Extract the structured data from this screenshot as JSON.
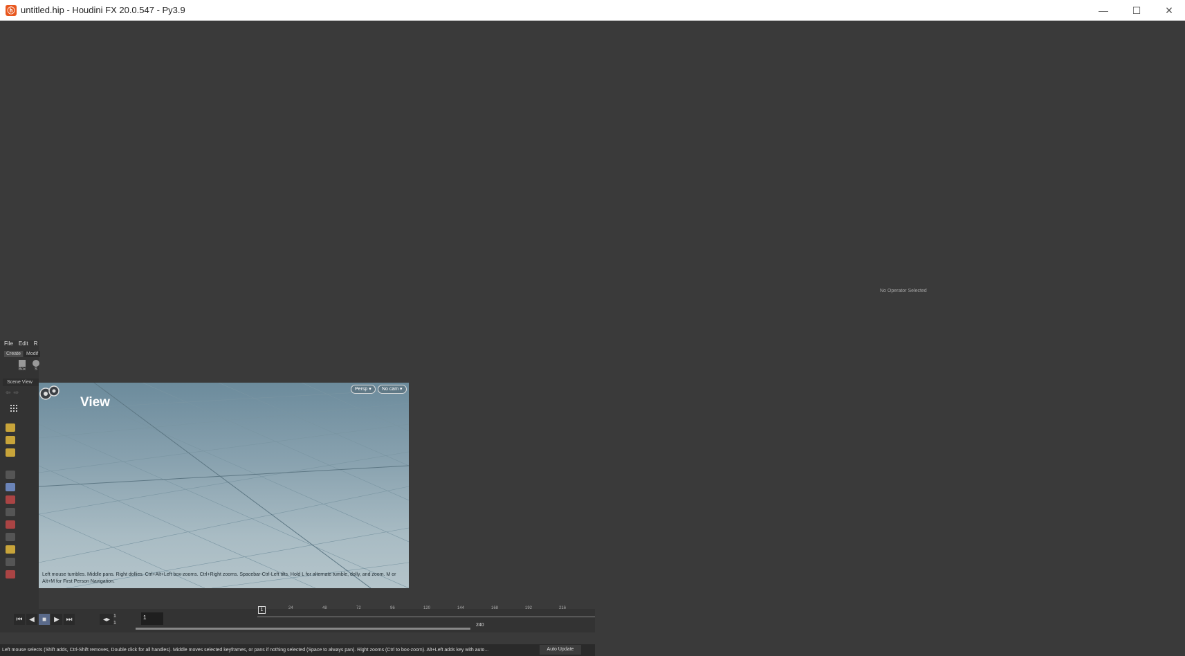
{
  "window": {
    "title": "untitled.hip - Houdini FX 20.0.547 - Py3.9",
    "controls": {
      "minimize": "—",
      "maximize": "☐",
      "close": "✕"
    }
  },
  "parameter_pane": {
    "message": "No Operator Selected"
  },
  "menu": {
    "items": [
      "File",
      "Edit",
      "R"
    ]
  },
  "shelf": {
    "tabs": [
      "Create",
      "Modif"
    ],
    "tools": [
      "Box",
      "S"
    ]
  },
  "scene_view": {
    "tab_label": "Scene View",
    "title": "View",
    "persp_button": "Persp ▾",
    "cam_button": "No cam ▾",
    "hint": "Left mouse tumbles. Middle pans. Right dollies. Ctrl+Alt+Left box-zooms. Ctrl+Right zooms. Spacebar-Ctrl-Left tilts. Hold L for alternate tumble, dolly, and zoom. M or Alt+M for First Person Navigation."
  },
  "playbar": {
    "current_frame": "1",
    "start_frame": "1",
    "range_start": "1",
    "range_end": "240",
    "ticks": [
      "24",
      "48",
      "72",
      "96",
      "120",
      "144",
      "168",
      "192",
      "216"
    ],
    "timeline_marker": "1"
  },
  "status": {
    "message": "Left mouse selects (Shift adds, Ctrl-Shift removes, Double click for all handles). Middle moves selected keyframes, or pans if nothing selected (Space to always pan). Right zooms (Ctrl to box-zoom). Alt+Left adds key with auto...",
    "auto_update": "Auto Update"
  }
}
